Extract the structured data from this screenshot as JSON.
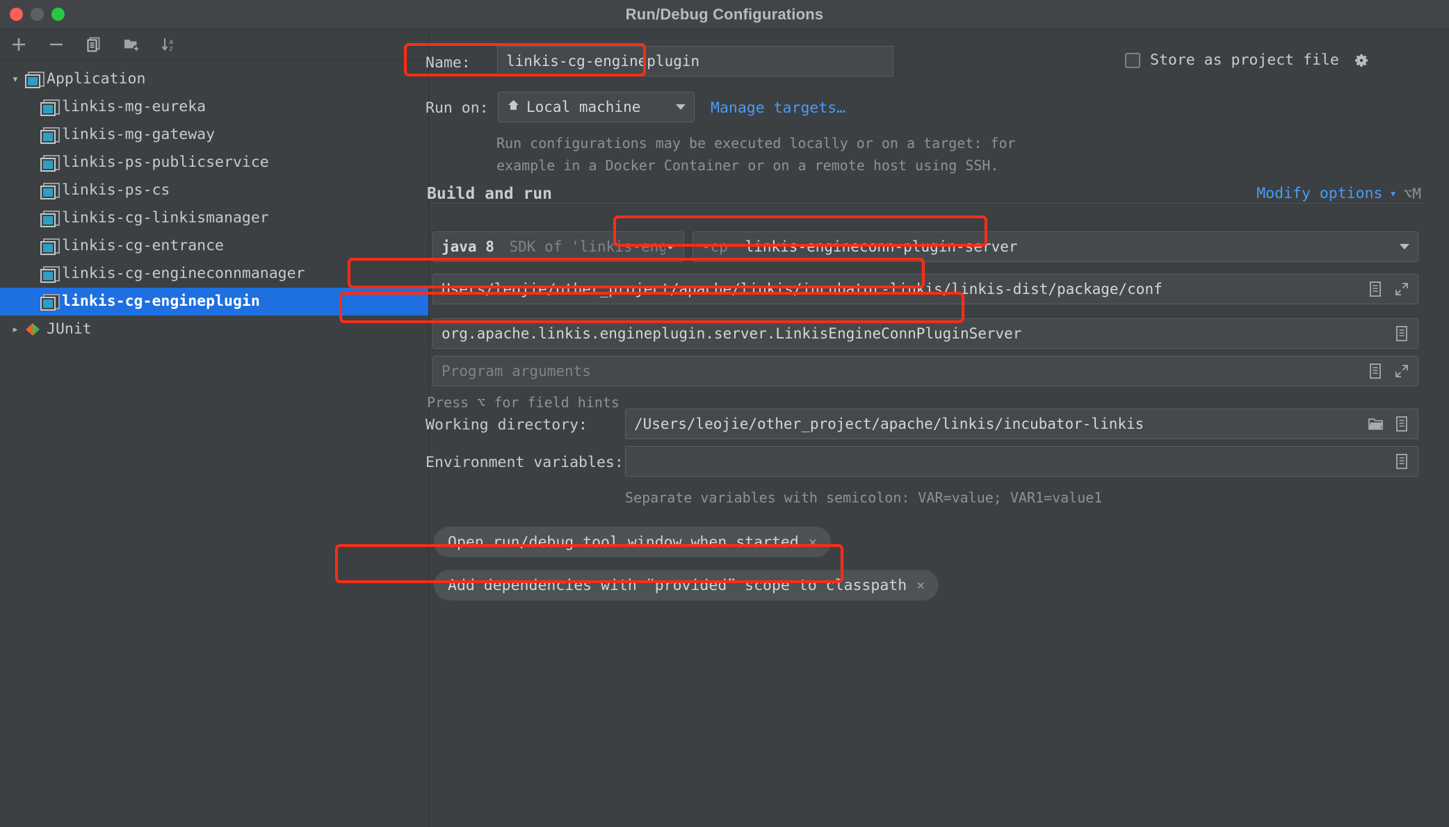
{
  "window": {
    "title": "Run/Debug Configurations",
    "traffic_lights": [
      "close",
      "minimize",
      "zoom"
    ]
  },
  "sidebar": {
    "toolbar": [
      {
        "name": "add",
        "glyph": "+"
      },
      {
        "name": "remove",
        "glyph": "−"
      },
      {
        "name": "copy",
        "glyph": "copy-icon"
      },
      {
        "name": "new-folder",
        "glyph": "new-folder-icon"
      },
      {
        "name": "sort-alphabetically",
        "glyph": "sort-az-icon"
      }
    ],
    "tree": [
      {
        "label": "Application",
        "level": 0,
        "expanded": true,
        "icon": "application-icon",
        "selected": false
      },
      {
        "label": "linkis-mg-eureka",
        "level": 1,
        "icon": "application-icon",
        "selected": false
      },
      {
        "label": "linkis-mg-gateway",
        "level": 1,
        "icon": "application-icon",
        "selected": false
      },
      {
        "label": "linkis-ps-publicservice",
        "level": 1,
        "icon": "application-icon",
        "selected": false
      },
      {
        "label": "linkis-ps-cs",
        "level": 1,
        "icon": "application-icon",
        "selected": false
      },
      {
        "label": "linkis-cg-linkismanager",
        "level": 1,
        "icon": "application-icon",
        "selected": false
      },
      {
        "label": "linkis-cg-entrance",
        "level": 1,
        "icon": "application-icon",
        "selected": false
      },
      {
        "label": "linkis-cg-engineconnmanager",
        "level": 1,
        "icon": "application-icon",
        "selected": false
      },
      {
        "label": "linkis-cg-engineplugin",
        "level": 1,
        "icon": "application-icon",
        "selected": true
      },
      {
        "label": "JUnit",
        "level": 0,
        "expanded": false,
        "icon": "junit-icon",
        "selected": false
      }
    ]
  },
  "form": {
    "name_label": "Name:",
    "name_value": "linkis-cg-engineplugin",
    "store_as_project_file_label": "Store as project file",
    "store_as_project_file_checked": false,
    "run_on_label": "Run on:",
    "run_on_value": "Local machine",
    "manage_targets_link": "Manage targets…",
    "run_on_hint_line1": "Run configurations may be executed locally or on a target: for",
    "run_on_hint_line2": "example in a Docker Container or on a remote host using SSH.",
    "build_and_run_title": "Build and run",
    "modify_options_link": "Modify options",
    "modify_options_shortcut": "⌥M",
    "jdk_value_bold": "java 8",
    "jdk_value_rest": "SDK of 'linkis-engin",
    "classpath_prefix": "-cp",
    "classpath_value": "linkis-engineconn-plugin-server",
    "vm_options_value": "Users/leojie/other_project/apache/linkis/incubator-linkis/linkis-dist/package/conf",
    "main_class_value": "org.apache.linkis.engineplugin.server.LinkisEngineConnPluginServer",
    "program_arguments_placeholder": "Program arguments",
    "field_hints": "Press ⌥ for field hints",
    "working_directory_label": "Working directory:",
    "working_directory_value": "/Users/leojie/other_project/apache/linkis/incubator-linkis",
    "environment_variables_label": "Environment variables:",
    "environment_variables_value": "",
    "environment_variables_hint": "Separate variables with semicolon: VAR=value; VAR1=value1",
    "chips": [
      {
        "label": "Open run/debug tool window when started",
        "close": "×",
        "highlighted": false
      },
      {
        "label": "Add dependencies with “provided” scope to classpath",
        "close": "×",
        "highlighted": true
      }
    ]
  },
  "annotations": {
    "highlight_color": "#fc2d16",
    "boxes": [
      "name-field",
      "classpath-field",
      "vm-options-field",
      "main-class-field",
      "provided-scope-chip"
    ]
  },
  "colors": {
    "accent_blue": "#1e6fe0",
    "link_blue": "#4a9bf7",
    "background": "#3c4043",
    "field_background": "#45494c",
    "highlight": "#fc2d16"
  }
}
